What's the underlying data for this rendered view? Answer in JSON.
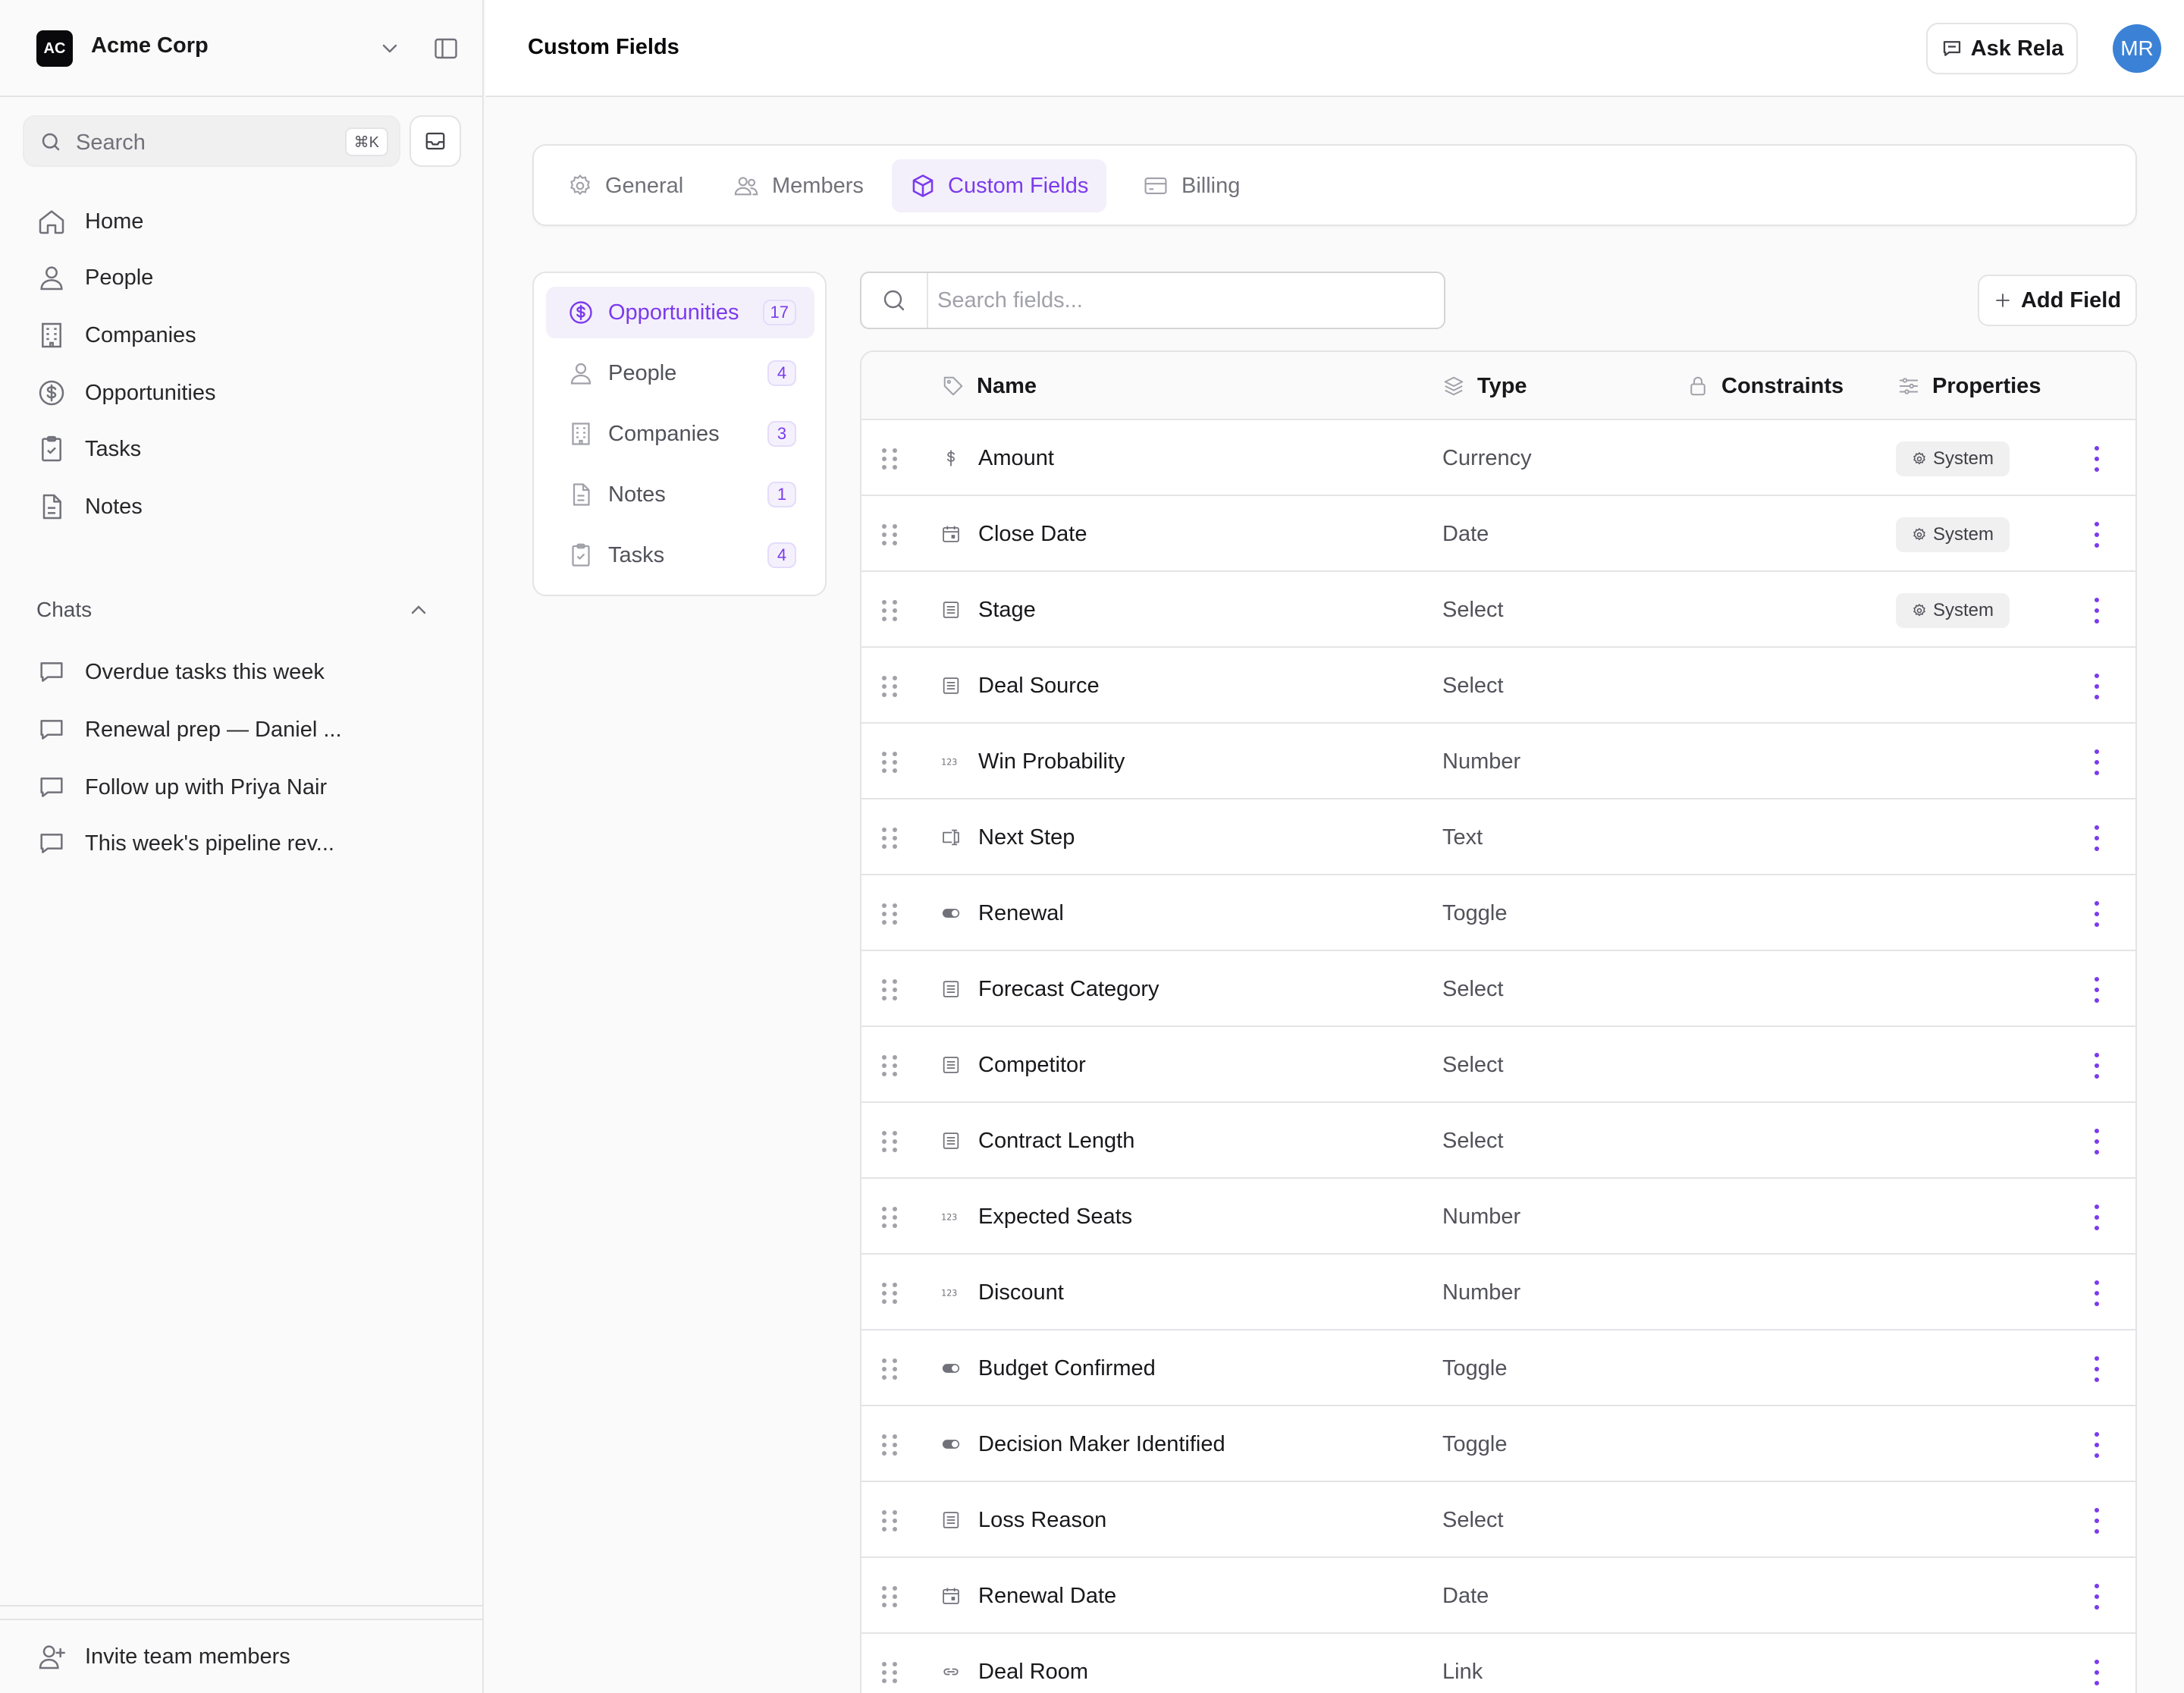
{
  "workspace": {
    "initials": "AC",
    "name": "Acme Corp"
  },
  "sidebar": {
    "search_label": "Search",
    "search_shortcut": "⌘K",
    "nav": [
      {
        "label": "Home",
        "icon": "home-icon"
      },
      {
        "label": "People",
        "icon": "person-icon"
      },
      {
        "label": "Companies",
        "icon": "building-icon"
      },
      {
        "label": "Opportunities",
        "icon": "dollar-circle-icon"
      },
      {
        "label": "Tasks",
        "icon": "clipboard-check-icon"
      },
      {
        "label": "Notes",
        "icon": "note-icon"
      }
    ],
    "chats_heading": "Chats",
    "chats": [
      {
        "label": "Overdue tasks this week"
      },
      {
        "label": "Renewal prep — Daniel ..."
      },
      {
        "label": "Follow up with Priya Nair"
      },
      {
        "label": "This week's pipeline rev..."
      }
    ],
    "invite_label": "Invite team members"
  },
  "header": {
    "title": "Custom Fields",
    "ask_label": "Ask Rela",
    "avatar_initials": "MR"
  },
  "tabs": [
    {
      "label": "General",
      "icon": "gear-icon",
      "active": false
    },
    {
      "label": "Members",
      "icon": "users-icon",
      "active": false
    },
    {
      "label": "Custom Fields",
      "icon": "cube-icon",
      "active": true
    },
    {
      "label": "Billing",
      "icon": "credit-card-icon",
      "active": false
    }
  ],
  "objects": [
    {
      "label": "Opportunities",
      "count": "17",
      "icon": "dollar-circle-icon",
      "active": true
    },
    {
      "label": "People",
      "count": "4",
      "icon": "person-icon",
      "active": false
    },
    {
      "label": "Companies",
      "count": "3",
      "icon": "building-icon",
      "active": false
    },
    {
      "label": "Notes",
      "count": "1",
      "icon": "note-icon",
      "active": false
    },
    {
      "label": "Tasks",
      "count": "4",
      "icon": "clipboard-check-icon",
      "active": false
    }
  ],
  "fields_search": {
    "placeholder": "Search fields..."
  },
  "add_field_label": "Add Field",
  "table": {
    "columns": [
      "Name",
      "Type",
      "Constraints",
      "Properties"
    ],
    "rows": [
      {
        "name": "Amount",
        "type": "Currency",
        "icon": "dollar-icon",
        "property": "System"
      },
      {
        "name": "Close Date",
        "type": "Date",
        "icon": "calendar-icon",
        "property": "System"
      },
      {
        "name": "Stage",
        "type": "Select",
        "icon": "list-icon",
        "property": "System"
      },
      {
        "name": "Deal Source",
        "type": "Select",
        "icon": "list-icon",
        "property": ""
      },
      {
        "name": "Win Probability",
        "type": "Number",
        "icon": "number-icon",
        "property": ""
      },
      {
        "name": "Next Step",
        "type": "Text",
        "icon": "text-field-icon",
        "property": ""
      },
      {
        "name": "Renewal",
        "type": "Toggle",
        "icon": "toggle-icon",
        "property": ""
      },
      {
        "name": "Forecast Category",
        "type": "Select",
        "icon": "list-icon",
        "property": ""
      },
      {
        "name": "Competitor",
        "type": "Select",
        "icon": "list-icon",
        "property": ""
      },
      {
        "name": "Contract Length",
        "type": "Select",
        "icon": "list-icon",
        "property": ""
      },
      {
        "name": "Expected Seats",
        "type": "Number",
        "icon": "number-icon",
        "property": ""
      },
      {
        "name": "Discount",
        "type": "Number",
        "icon": "number-icon",
        "property": ""
      },
      {
        "name": "Budget Confirmed",
        "type": "Toggle",
        "icon": "toggle-icon",
        "property": ""
      },
      {
        "name": "Decision Maker Identified",
        "type": "Toggle",
        "icon": "toggle-icon",
        "property": ""
      },
      {
        "name": "Loss Reason",
        "type": "Select",
        "icon": "list-icon",
        "property": ""
      },
      {
        "name": "Renewal Date",
        "type": "Date",
        "icon": "calendar-icon",
        "property": ""
      },
      {
        "name": "Deal Room",
        "type": "Link",
        "icon": "link-icon",
        "property": ""
      }
    ]
  },
  "colors": {
    "accent": "#7c3aed",
    "avatar": "#3b82d6",
    "border": "#e4e4e7"
  }
}
